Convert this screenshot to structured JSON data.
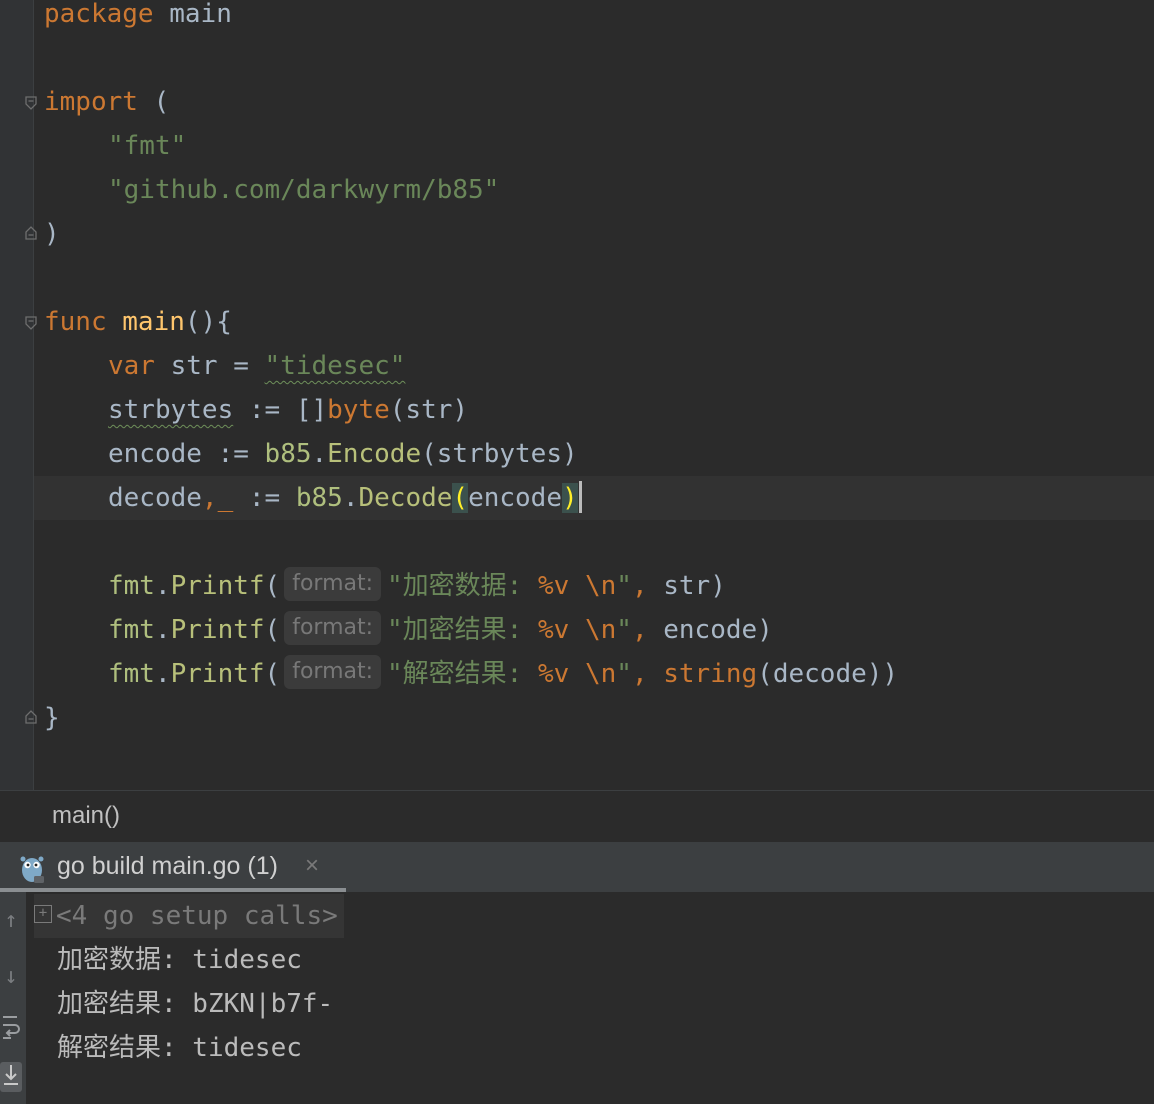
{
  "editor": {
    "lines": {
      "l1": {
        "kw": "package",
        "rest": " main"
      },
      "l3": {
        "kw": "import",
        "rest": " ("
      },
      "l4": {
        "str": "\"fmt\""
      },
      "l5": {
        "str": "\"github.com/darkwyrm/b85\""
      },
      "l6": {
        "text": ")"
      },
      "l8": {
        "kw": "func",
        "fn": "main",
        "rest": "(){"
      },
      "l9": {
        "kw": "var",
        "mid": " str = ",
        "str": "\"tidesec\""
      },
      "l10": {
        "var": "strbytes",
        "mid": " := []",
        "type": "byte",
        "rest": "(str)"
      },
      "l11": {
        "var": "encode",
        "mid": " := ",
        "pkg": "b85",
        "dot": ".",
        "call": "Encode",
        "rest": "(strbytes)"
      },
      "l12": {
        "var": "decode",
        "comma": ",",
        "blank": "_",
        "mid": " := ",
        "pkg": "b85",
        "dot": ".",
        "call": "Decode",
        "open": "(",
        "arg": "encode",
        "close": ")"
      },
      "l14": {
        "pkg": "fmt",
        "dot": ".",
        "call": "Printf",
        "open": "(",
        "hint": "format:",
        "str_a": "\"加密数据: ",
        "verb": "%v",
        "sp": " ",
        "esc": "\\n",
        "str_b": "\"",
        "comma": ",",
        "rest": " str)"
      },
      "l15": {
        "pkg": "fmt",
        "dot": ".",
        "call": "Printf",
        "open": "(",
        "hint": "format:",
        "str_a": "\"加密结果: ",
        "verb": "%v",
        "sp": " ",
        "esc": "\\n",
        "str_b": "\"",
        "comma": ",",
        "rest": " encode)"
      },
      "l16": {
        "pkg": "fmt",
        "dot": ".",
        "call": "Printf",
        "open": "(",
        "hint": "format:",
        "str_a": "\"解密结果: ",
        "verb": "%v",
        "sp": " ",
        "esc": "\\n",
        "str_b": "\"",
        "comma": ",",
        "type": " string",
        "rest": "(decode))"
      },
      "l17": {
        "text": "}"
      }
    }
  },
  "breadcrumb": {
    "label": "main()"
  },
  "run_tab": {
    "label": "go build main.go (1)",
    "close": "×"
  },
  "console": {
    "setup_calls": "<4 go setup calls>",
    "lines": [
      "加密数据: tidesec",
      "加密结果: bZKN|b7f-",
      "解密结果: tidesec"
    ]
  },
  "colors": {
    "background": "#2b2b2b",
    "keyword": "#cc7832",
    "function": "#ffc66d",
    "string": "#6a8759",
    "text": "#a9b7c6"
  }
}
